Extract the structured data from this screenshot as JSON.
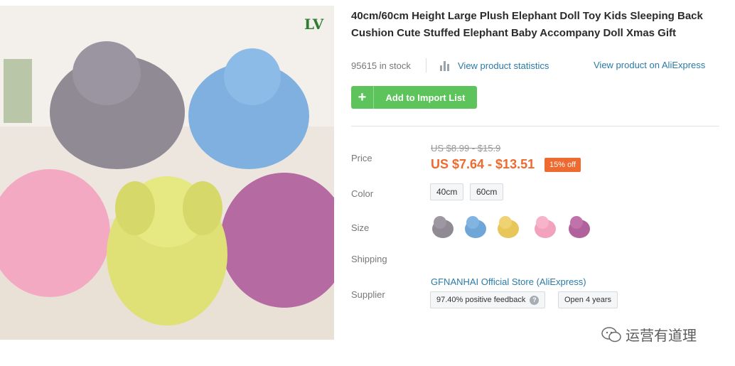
{
  "product": {
    "title": "40cm/60cm Height Large Plush Elephant Doll Toy Kids Sleeping Back Cushion Cute Stuffed Elephant Baby Accompany Doll Xmas Gift",
    "stock": "95615 in stock",
    "stats_link": "View product statistics",
    "aliexpress_link": "View product on AliExpress",
    "image_tag": "LV"
  },
  "actions": {
    "add_label": "Add to Import List",
    "add_icon": "plus-icon"
  },
  "price": {
    "label": "Price",
    "original": "US $8.99 - $15.9",
    "current": "US $7.64 - $13.51",
    "discount": "15% off",
    "accent_color": "#ef6a2e"
  },
  "color": {
    "label": "Color",
    "options": [
      "40cm",
      "60cm"
    ]
  },
  "size": {
    "label": "Size",
    "swatches": [
      {
        "name": "grey",
        "color": "#8f8a93"
      },
      {
        "name": "blue",
        "color": "#6fa6d8"
      },
      {
        "name": "yellow",
        "color": "#e7c65a"
      },
      {
        "name": "pink",
        "color": "#f2a2bd"
      },
      {
        "name": "purple",
        "color": "#b1619c"
      }
    ]
  },
  "shipping": {
    "label": "Shipping"
  },
  "supplier": {
    "label": "Supplier",
    "name": "GFNANHAI Official Store (AliExpress)",
    "feedback": "97.40% positive feedback",
    "open": "Open 4 years"
  },
  "watermark": {
    "text": "运营有道理"
  },
  "colors": {
    "link": "#2b7aa6",
    "button": "#5cc45a"
  }
}
